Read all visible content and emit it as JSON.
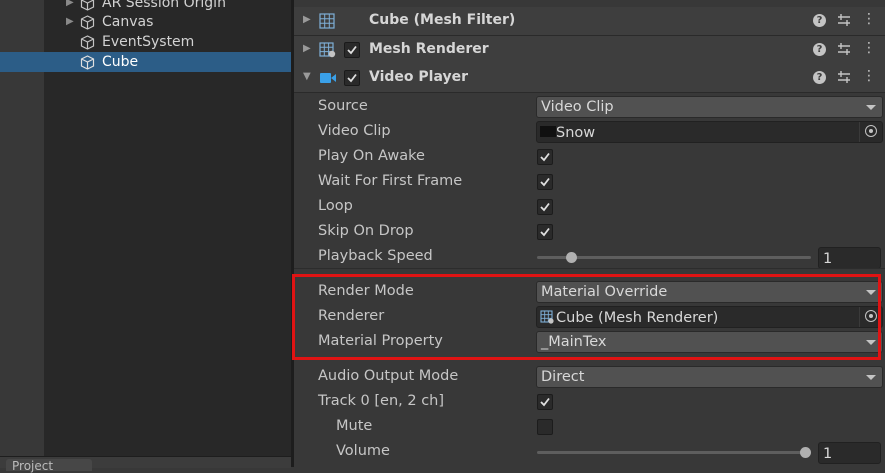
{
  "hierarchy": {
    "items": [
      {
        "label": "AR Session Origin",
        "expandable": true,
        "selected": false
      },
      {
        "label": "Canvas",
        "expandable": true,
        "selected": false
      },
      {
        "label": "EventSystem",
        "expandable": false,
        "selected": false
      },
      {
        "label": "Cube",
        "expandable": false,
        "selected": true
      }
    ],
    "footer_tab_label": "Project"
  },
  "components": [
    {
      "title": "Cube (Mesh Filter)",
      "icon": "grid-icon",
      "has_checkbox": false,
      "expanded": false
    },
    {
      "title": "Mesh Renderer",
      "icon": "mesh-renderer-icon",
      "has_checkbox": true,
      "checked": true,
      "expanded": false
    },
    {
      "title": "Video Player",
      "icon": "video-player-icon",
      "has_checkbox": true,
      "checked": true,
      "expanded": true
    }
  ],
  "help_glyph": "?",
  "video_player": {
    "source": {
      "label": "Source",
      "value": "Video Clip"
    },
    "video_clip": {
      "label": "Video Clip",
      "value": "Snow"
    },
    "play_on_awake": {
      "label": "Play On Awake",
      "checked": true
    },
    "wait_first_frame": {
      "label": "Wait For First Frame",
      "checked": true
    },
    "loop": {
      "label": "Loop",
      "checked": true
    },
    "skip_on_drop": {
      "label": "Skip On Drop",
      "checked": true
    },
    "playback_speed": {
      "label": "Playback Speed",
      "value": "1",
      "slider_fraction": 0.11
    },
    "render_mode": {
      "label": "Render Mode",
      "value": "Material Override"
    },
    "renderer": {
      "label": "Renderer",
      "value": "Cube (Mesh Renderer)"
    },
    "material_property": {
      "label": "Material Property",
      "value": "_MainTex"
    },
    "audio_output_mode": {
      "label": "Audio Output Mode",
      "value": "Direct"
    },
    "track0": {
      "label": "Track 0 [en, 2 ch]",
      "checked": true
    },
    "mute": {
      "label": "Mute",
      "checked": false
    },
    "volume": {
      "label": "Volume",
      "value": "1",
      "slider_fraction": 1.0
    }
  },
  "colors": {
    "highlight": "#e01313",
    "selection": "#2c5d87",
    "video_icon": "#3aa0e8"
  }
}
